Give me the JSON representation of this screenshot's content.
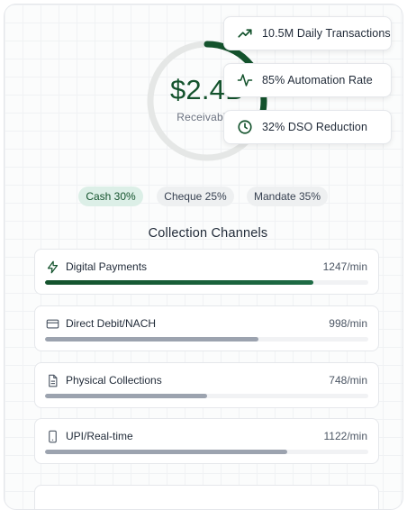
{
  "hero": {
    "value": "$2.4B",
    "label": "Receivables",
    "ring_progress": 0.35,
    "accent_color": "#14532d",
    "track_color": "#e5e7e6"
  },
  "stats": [
    {
      "icon": "trending-up-icon",
      "text": "10.5M Daily Transactions"
    },
    {
      "icon": "activity-icon",
      "text": "85% Automation Rate"
    },
    {
      "icon": "clock-icon",
      "text": "32% DSO Reduction"
    }
  ],
  "filters": [
    {
      "label": "Cash 30%",
      "active": true
    },
    {
      "label": "Cheque 25%",
      "active": false
    },
    {
      "label": "Mandate 35%",
      "active": false
    }
  ],
  "section_title": "Collection Channels",
  "channels": [
    {
      "icon": "lightning-icon",
      "name": "Digital Payments",
      "rate": "1247/min",
      "fill": 0.83,
      "primary": true
    },
    {
      "icon": "credit-card-icon",
      "name": "Direct Debit/NACH",
      "rate": "998/min",
      "fill": 0.66,
      "primary": false
    },
    {
      "icon": "document-icon",
      "name": "Physical Collections",
      "rate": "748/min",
      "fill": 0.5,
      "primary": false
    },
    {
      "icon": "smartphone-icon",
      "name": "UPI/Real-time",
      "rate": "1122/min",
      "fill": 0.75,
      "primary": false
    }
  ]
}
